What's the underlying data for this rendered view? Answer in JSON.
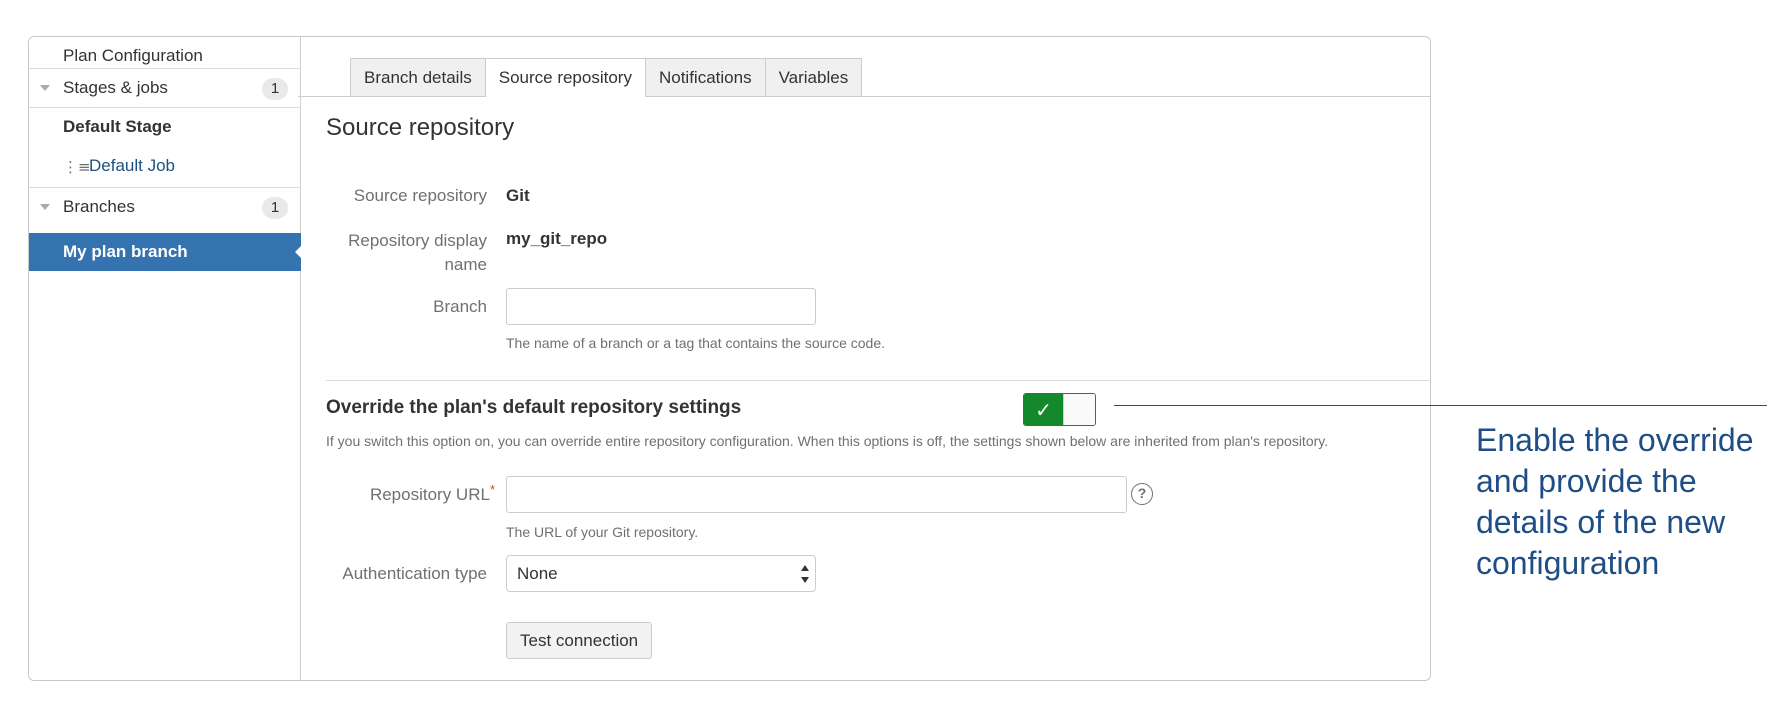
{
  "sidebar": {
    "plan_configuration": "Plan Configuration",
    "stages_jobs": {
      "label": "Stages & jobs",
      "count": "1"
    },
    "default_stage": "Default Stage",
    "default_job": "Default Job",
    "branches": {
      "label": "Branches",
      "count": "1"
    },
    "active_branch": "My plan branch"
  },
  "tabs": [
    {
      "label": "Branch details",
      "active": false
    },
    {
      "label": "Source repository",
      "active": true
    },
    {
      "label": "Notifications",
      "active": false
    },
    {
      "label": "Variables",
      "active": false
    }
  ],
  "page_title": "Source repository",
  "form": {
    "source_repository": {
      "label": "Source repository",
      "value": "Git"
    },
    "display_name": {
      "label_line1": "Repository display",
      "label_line2": "name",
      "value": "my_git_repo"
    },
    "branch": {
      "label": "Branch",
      "value": "",
      "help": "The name of a branch or a tag that contains the source code."
    }
  },
  "override": {
    "title": "Override the plan's default repository settings",
    "enabled": true,
    "description": "If you switch this option on, you can override entire repository configuration. When this options is off, the settings shown below are inherited from plan's repository.",
    "repo_url": {
      "label": "Repository URL",
      "required_mark": "*",
      "value": "",
      "help": "The URL of your Git repository.",
      "help_icon": "?"
    },
    "auth_type": {
      "label": "Authentication type",
      "selected": "None"
    },
    "test_button": "Test connection"
  },
  "callout": "Enable the override and provide the details of the new configuration",
  "colors": {
    "sidebar_active": "#3572b0",
    "toggle_on": "#14892c",
    "callout": "#1f4e86",
    "link": "#205081"
  }
}
